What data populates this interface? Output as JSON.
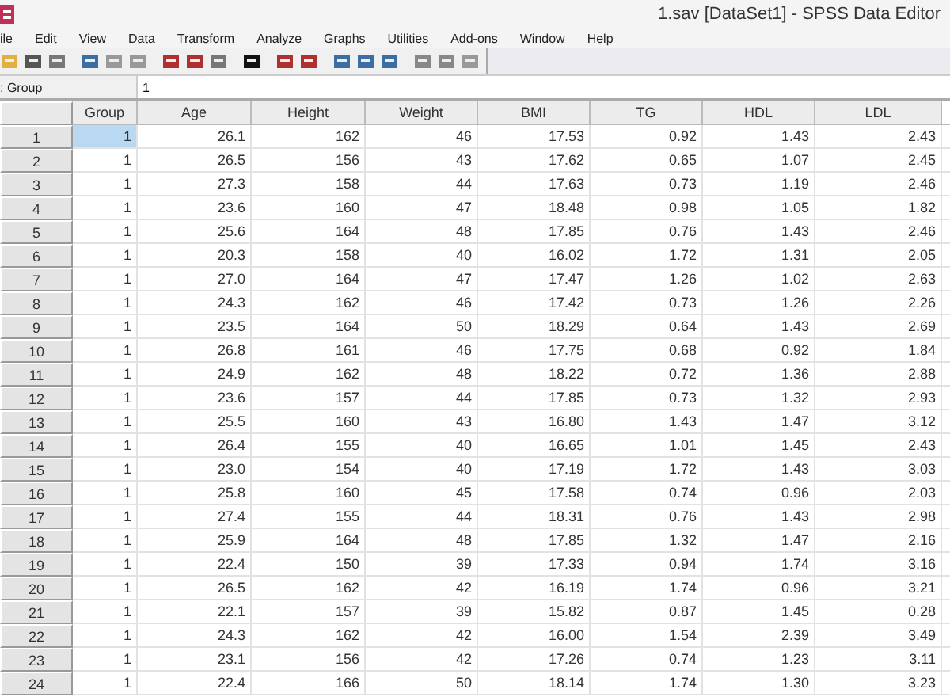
{
  "window": {
    "title": "1.sav [DataSet1] - SPSS Data Editor"
  },
  "menu": [
    "ile",
    "Edit",
    "View",
    "Data",
    "Transform",
    "Analyze",
    "Graphs",
    "Utilities",
    "Add-ons",
    "Window",
    "Help"
  ],
  "cell_editor": {
    "variable": ": Group",
    "value": "1"
  },
  "table": {
    "columns": [
      "Group",
      "Age",
      "Height",
      "Weight",
      "BMI",
      "TG",
      "HDL",
      "LDL"
    ],
    "rows": [
      {
        "label": "1",
        "first_cell_selected": true,
        "cells": [
          "1",
          "26.1",
          "162",
          "46",
          "17.53",
          "0.92",
          "1.43",
          "2.43"
        ]
      },
      {
        "label": "2",
        "first_cell_selected": false,
        "cells": [
          "1",
          "26.5",
          "156",
          "43",
          "17.62",
          "0.65",
          "1.07",
          "2.45"
        ]
      },
      {
        "label": "3",
        "first_cell_selected": false,
        "cells": [
          "1",
          "27.3",
          "158",
          "44",
          "17.63",
          "0.73",
          "1.19",
          "2.46"
        ]
      },
      {
        "label": "4",
        "first_cell_selected": false,
        "cells": [
          "1",
          "23.6",
          "160",
          "47",
          "18.48",
          "0.98",
          "1.05",
          "1.82"
        ]
      },
      {
        "label": "5",
        "first_cell_selected": false,
        "cells": [
          "1",
          "25.6",
          "164",
          "48",
          "17.85",
          "0.76",
          "1.43",
          "2.46"
        ]
      },
      {
        "label": "6",
        "first_cell_selected": false,
        "cells": [
          "1",
          "20.3",
          "158",
          "40",
          "16.02",
          "1.72",
          "1.31",
          "2.05"
        ]
      },
      {
        "label": "7",
        "first_cell_selected": false,
        "cells": [
          "1",
          "27.0",
          "164",
          "47",
          "17.47",
          "1.26",
          "1.02",
          "2.63"
        ]
      },
      {
        "label": "8",
        "first_cell_selected": false,
        "cells": [
          "1",
          "24.3",
          "162",
          "46",
          "17.42",
          "0.73",
          "1.26",
          "2.26"
        ]
      },
      {
        "label": "9",
        "first_cell_selected": false,
        "cells": [
          "1",
          "23.5",
          "164",
          "50",
          "18.29",
          "0.64",
          "1.43",
          "2.69"
        ]
      },
      {
        "label": "10",
        "first_cell_selected": false,
        "cells": [
          "1",
          "26.8",
          "161",
          "46",
          "17.75",
          "0.68",
          "0.92",
          "1.84"
        ]
      },
      {
        "label": "11",
        "first_cell_selected": false,
        "cells": [
          "1",
          "24.9",
          "162",
          "48",
          "18.22",
          "0.72",
          "1.36",
          "2.88"
        ]
      },
      {
        "label": "12",
        "first_cell_selected": false,
        "cells": [
          "1",
          "23.6",
          "157",
          "44",
          "17.85",
          "0.73",
          "1.32",
          "2.93"
        ]
      },
      {
        "label": "13",
        "first_cell_selected": false,
        "cells": [
          "1",
          "25.5",
          "160",
          "43",
          "16.80",
          "1.43",
          "1.47",
          "3.12"
        ]
      },
      {
        "label": "14",
        "first_cell_selected": false,
        "cells": [
          "1",
          "26.4",
          "155",
          "40",
          "16.65",
          "1.01",
          "1.45",
          "2.43"
        ]
      },
      {
        "label": "15",
        "first_cell_selected": false,
        "cells": [
          "1",
          "23.0",
          "154",
          "40",
          "17.19",
          "1.72",
          "1.43",
          "3.03"
        ]
      },
      {
        "label": "16",
        "first_cell_selected": false,
        "cells": [
          "1",
          "25.8",
          "160",
          "45",
          "17.58",
          "0.74",
          "0.96",
          "2.03"
        ]
      },
      {
        "label": "17",
        "first_cell_selected": false,
        "cells": [
          "1",
          "27.4",
          "155",
          "44",
          "18.31",
          "0.76",
          "1.43",
          "2.98"
        ]
      },
      {
        "label": "18",
        "first_cell_selected": false,
        "cells": [
          "1",
          "25.9",
          "164",
          "48",
          "17.85",
          "1.32",
          "1.47",
          "2.16"
        ]
      },
      {
        "label": "19",
        "first_cell_selected": false,
        "cells": [
          "1",
          "22.4",
          "150",
          "39",
          "17.33",
          "0.94",
          "1.74",
          "3.16"
        ]
      },
      {
        "label": "20",
        "first_cell_selected": false,
        "cells": [
          "1",
          "26.5",
          "162",
          "42",
          "16.19",
          "1.74",
          "0.96",
          "3.21"
        ]
      },
      {
        "label": "21",
        "first_cell_selected": false,
        "cells": [
          "1",
          "22.1",
          "157",
          "39",
          "15.82",
          "0.87",
          "1.45",
          "0.28"
        ]
      },
      {
        "label": "22",
        "first_cell_selected": false,
        "cells": [
          "1",
          "24.3",
          "162",
          "42",
          "16.00",
          "1.54",
          "2.39",
          "3.49"
        ]
      },
      {
        "label": "23",
        "first_cell_selected": false,
        "cells": [
          "1",
          "23.1",
          "156",
          "42",
          "17.26",
          "0.74",
          "1.23",
          "3.11"
        ]
      },
      {
        "label": "24",
        "first_cell_selected": false,
        "cells": [
          "1",
          "22.4",
          "166",
          "50",
          "18.14",
          "1.74",
          "1.30",
          "3.23"
        ]
      }
    ]
  }
}
